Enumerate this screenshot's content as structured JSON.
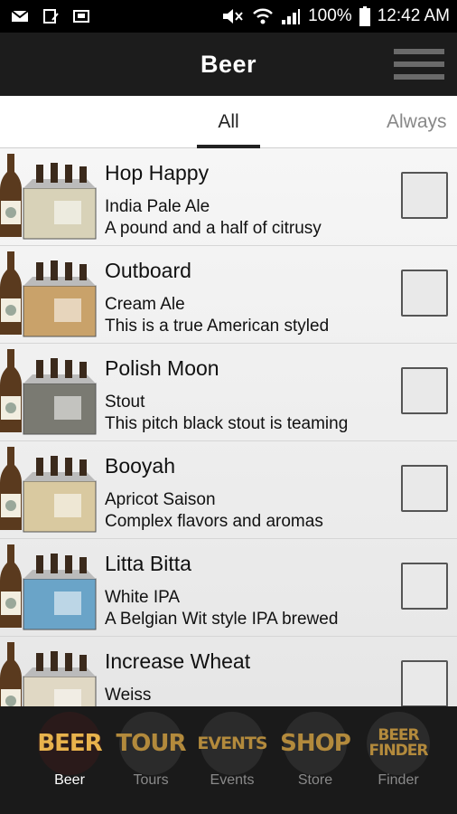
{
  "status_bar": {
    "battery": "100%",
    "time": "12:42 AM"
  },
  "header": {
    "title": "Beer"
  },
  "tabs": [
    {
      "label": "All"
    },
    {
      "label": "Always"
    }
  ],
  "beers": [
    {
      "name": "Hop Happy",
      "style": "India Pale Ale",
      "description": "A pound and a half of citrusy"
    },
    {
      "name": "Outboard",
      "style": "Cream Ale",
      "description": "This is a true American styled"
    },
    {
      "name": "Polish Moon",
      "style": "Stout",
      "description": "This pitch black stout is teaming"
    },
    {
      "name": "Booyah",
      "style": "Apricot Saison",
      "description": "Complex flavors and aromas"
    },
    {
      "name": "Litta Bitta",
      "style": "White IPA",
      "description": "A Belgian Wit style IPA brewed"
    },
    {
      "name": "Increase Wheat",
      "style": "Weiss",
      "description": ""
    }
  ],
  "nav": [
    {
      "badge": "BEER",
      "label": "Beer"
    },
    {
      "badge": "TOUR",
      "label": "Tours"
    },
    {
      "badge": "EVENTS",
      "label": "Events"
    },
    {
      "badge": "SHOP",
      "label": "Store"
    },
    {
      "badge": "BEER FINDER",
      "label": "Finder"
    }
  ],
  "colors": {
    "header_bg": "#1c1c1c",
    "nav_bg": "#1a1a1a",
    "badge_active": "#e8b24c",
    "badge_inactive": "#b38a3c"
  }
}
